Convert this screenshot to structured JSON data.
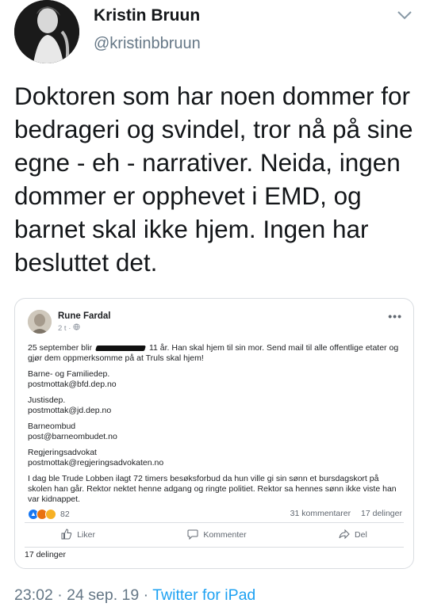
{
  "author": {
    "name": "Kristin Bruun",
    "handle": "@kristinbbruun"
  },
  "tweet": {
    "text": "Doktoren som har noen dommer for bedrageri og svindel, tror nå på sine egne - eh - narrativer. Neida, ingen dommer er opphevet i EMD, og barnet skal ikke hjem. Ingen har besluttet det."
  },
  "embedded_post": {
    "author": "Rune Fardal",
    "time": "2 t · ",
    "intro_before": "25 september blir ",
    "intro_after": " 11 år. Han skal hjem til sin mor. Send mail til alle offentlige etater og gjør dem oppmerksomme på at Truls skal hjem!",
    "contacts": [
      {
        "name": "Barne- og Familiedep.",
        "email": "postmottak@bfd.dep.no"
      },
      {
        "name": "Justisdep.",
        "email": "postmottak@jd.dep.no"
      },
      {
        "name": "Barneombud",
        "email": "post@barneombudet.no"
      },
      {
        "name": "Regjeringsadvokat",
        "email": "postmottak@regjeringsadvokaten.no"
      }
    ],
    "closing": "I dag ble Trude Lobben ilagt 72 timers besøksforbud da hun ville gi sin sønn et bursdagskort på skolen han går. Rektor nektet henne adgang og ringte politiet. Rektor sa hennes sønn ikke viste han var kidnappet.",
    "reactions_count": "82",
    "comments_count": "31 kommentarer",
    "shares_count": "17 delinger",
    "actions": {
      "like": "Liker",
      "comment": "Kommenter",
      "share": "Del"
    },
    "footer_shares": "17 delinger",
    "reaction_colors": {
      "like": "#1877f2",
      "angry": "#e9710f",
      "sad": "#f7b125"
    }
  },
  "meta": {
    "time": "23:02",
    "separator": " · ",
    "date": "24 sep. 19",
    "source": "Twitter for iPad"
  },
  "icons": {
    "menu": "chevron-down-icon",
    "post_menu": "more-dots-icon",
    "audience": "globe-icon",
    "like": "thumbs-up-icon",
    "comment": "comment-bubble-icon",
    "share": "share-arrow-icon"
  }
}
